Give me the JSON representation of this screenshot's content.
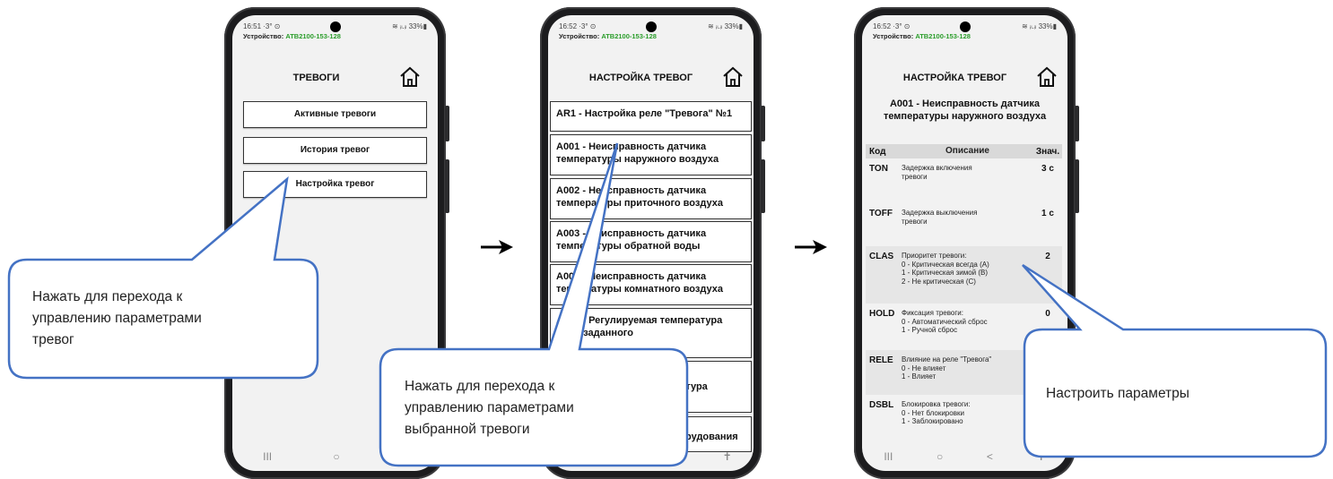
{
  "status_bars": [
    {
      "time": "16:51 ·3° ⊙",
      "right": "≋ ᵢₗ.ᵢₗ 33%▮"
    },
    {
      "time": "16:52 ·3° ⊙",
      "right": "≋ ᵢₗ.ᵢₗ 33%▮"
    },
    {
      "time": "16:52 ·3° ⊙",
      "right": "≋ ᵢₗ.ᵢₗ 33%▮"
    }
  ],
  "device": {
    "label": "Устройство:",
    "id": "ATB2100-153-128"
  },
  "screen1": {
    "title": "ТРЕВОГИ",
    "buttons": [
      "Активные тревоги",
      "История тревог",
      "Настройка тревог"
    ]
  },
  "screen2": {
    "title": "НАСТРОЙКА ТРЕВОГ",
    "items": [
      "AR1 - Настройка реле \"Тревога\" №1",
      "A001 - Неисправность датчика температуры наружного воздуха",
      "A002 - Неисправность датчика температуры приточного воздуха",
      "A003 - Неисправность датчика температуры обратной воды",
      "A004 - Неисправность датчика температуры комнатного воздуха",
      "A005 - Регулируемая температура ниже заданного",
      "A006 - Аварийная температура воздуха ниже заданного",
      "A007 - Неисправность оборудования"
    ]
  },
  "screen3": {
    "title": "НАСТРОЙКА ТРЕВОГ",
    "subtitle": "A001 - Неисправность датчика температуры наружного воздуха",
    "columns": {
      "code": "Код",
      "desc": "Описание",
      "val": "Знач."
    },
    "rows": [
      {
        "code": "TON",
        "desc": "Задержка включения\nтревоги",
        "val": "3 с"
      },
      {
        "code": "TOFF",
        "desc": "Задержка выключения\nтревоги",
        "val": "1 с"
      },
      {
        "code": "CLAS",
        "desc": "Приоритет тревоги:\n0 - Критическая всегда (A)\n1 - Критическая зимой (B)\n2 - Не критическая (C)",
        "val": "2"
      },
      {
        "code": "HOLD",
        "desc": "Фиксация тревоги:\n0 - Автоматический сброс\n1 - Ручной сброс",
        "val": "0"
      },
      {
        "code": "RELE",
        "desc": "Влияние на реле \"Тревога\"\n0 - Не влияет\n1 - Влияет",
        "val": "1"
      },
      {
        "code": "DSBL",
        "desc": "Блокировка тревоги:\n0 - Нет блокировки\n1 - Заблокировано",
        "val": "0"
      }
    ]
  },
  "nav": {
    "recent": "III",
    "home": "○",
    "back": "<",
    "accessibility": "✝"
  },
  "callouts": {
    "c1": "Нажать для перехода к\nуправлению параметрами\nтревог",
    "c2": "Нажать для перехода к\nуправлению параметрами\nвыбранной тревоги",
    "c3": "Настроить параметры"
  },
  "icons": [
    "home-icon",
    "arrow-right-icon",
    "camera-icon"
  ],
  "colors": {
    "device_id": "#2a9d2a",
    "callout_border": "#4472c4"
  }
}
